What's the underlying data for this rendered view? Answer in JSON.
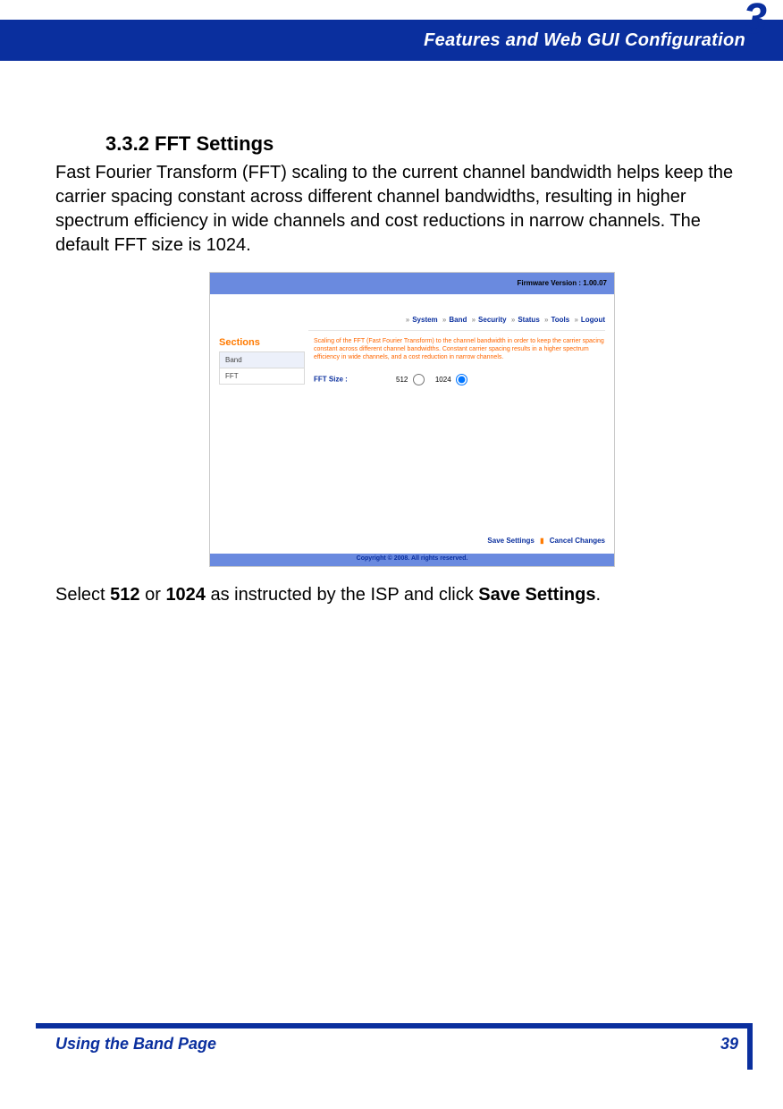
{
  "header": {
    "chapter_number": "3",
    "title": "Features and Web GUI Configuration"
  },
  "section": {
    "heading": "3.3.2 FFT Settings",
    "para1": "Fast Fourier Transform (FFT) scaling to the current channel bandwidth helps keep the carrier spacing constant across different channel bandwidths, resulting in higher spectrum efficiency in wide channels and cost reductions in narrow channels. The default FFT size is 1024.",
    "para2_pre": "Select ",
    "para2_b1": "512",
    "para2_mid": " or ",
    "para2_b2": "1024",
    "para2_mid2": " as instructed by the ISP and click ",
    "para2_b3": "Save Settings",
    "para2_post": "."
  },
  "screenshot": {
    "firmware": "Firmware Version : 1.00.07",
    "nav": {
      "system": "System",
      "band": "Band",
      "security": "Security",
      "status": "Status",
      "tools": "Tools",
      "logout": "Logout"
    },
    "sidebar": {
      "title": "Sections",
      "items": [
        "Band",
        "FFT"
      ]
    },
    "main": {
      "description": "Scaling of the FFT (Fast Fourier Transform) to the channel bandwidth in order to keep the carrier spacing constant across different channel bandwidths. Constant carrier spacing results in a higher spectrum efficiency in wide channels, and a cost reduction in narrow channels.",
      "fft_label": "FFT Size :",
      "opt512": "512",
      "opt1024": "1024",
      "selected": "1024"
    },
    "actions": {
      "save": "Save Settings",
      "cancel": "Cancel Changes"
    },
    "copyright": "Copyright © 2008.  All rights reserved."
  },
  "footer": {
    "left": "Using the Band Page",
    "page": "39"
  }
}
